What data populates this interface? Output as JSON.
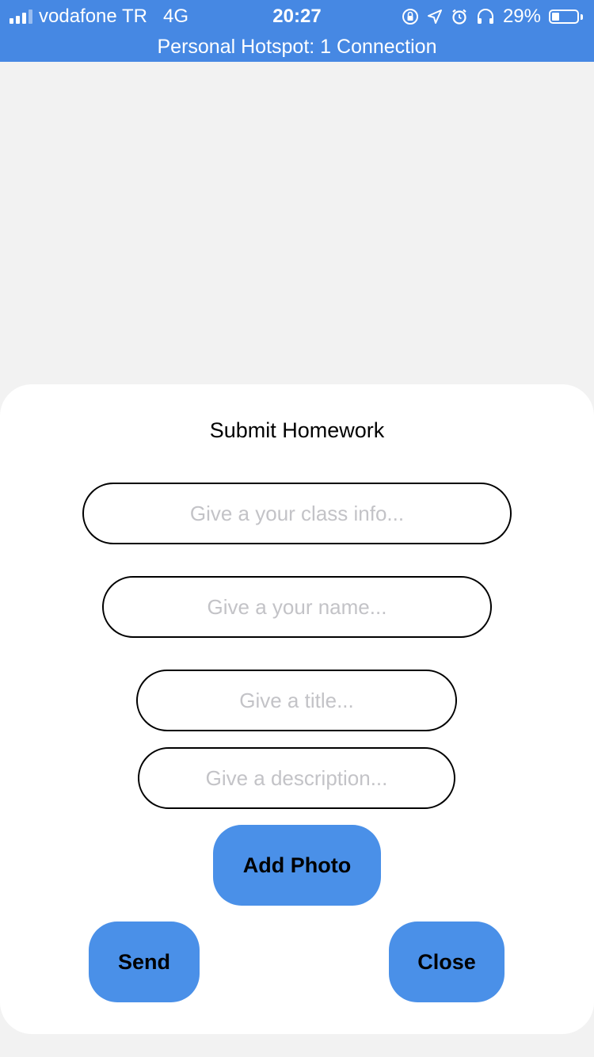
{
  "status_bar": {
    "carrier": "vodafone TR",
    "network": "4G",
    "time": "20:27",
    "battery": "29%",
    "battery_level": 0.29,
    "hotspot": "Personal Hotspot: 1 Connection",
    "bg_color": "#4688e3",
    "icons": [
      "signal-icon",
      "orientation-lock-icon",
      "location-icon",
      "alarm-icon",
      "headphones-icon",
      "battery-icon"
    ]
  },
  "modal": {
    "title": "Submit Homework",
    "fields": {
      "class_info": {
        "value": "",
        "placeholder": "Give a your class info..."
      },
      "name": {
        "value": "",
        "placeholder": "Give a your name..."
      },
      "title": {
        "value": "",
        "placeholder": "Give a title..."
      },
      "description": {
        "value": "",
        "placeholder": "Give a description..."
      }
    },
    "add_photo_label": "Add Photo",
    "send_label": "Send",
    "close_label": "Close",
    "button_color": "#4a90e8"
  }
}
